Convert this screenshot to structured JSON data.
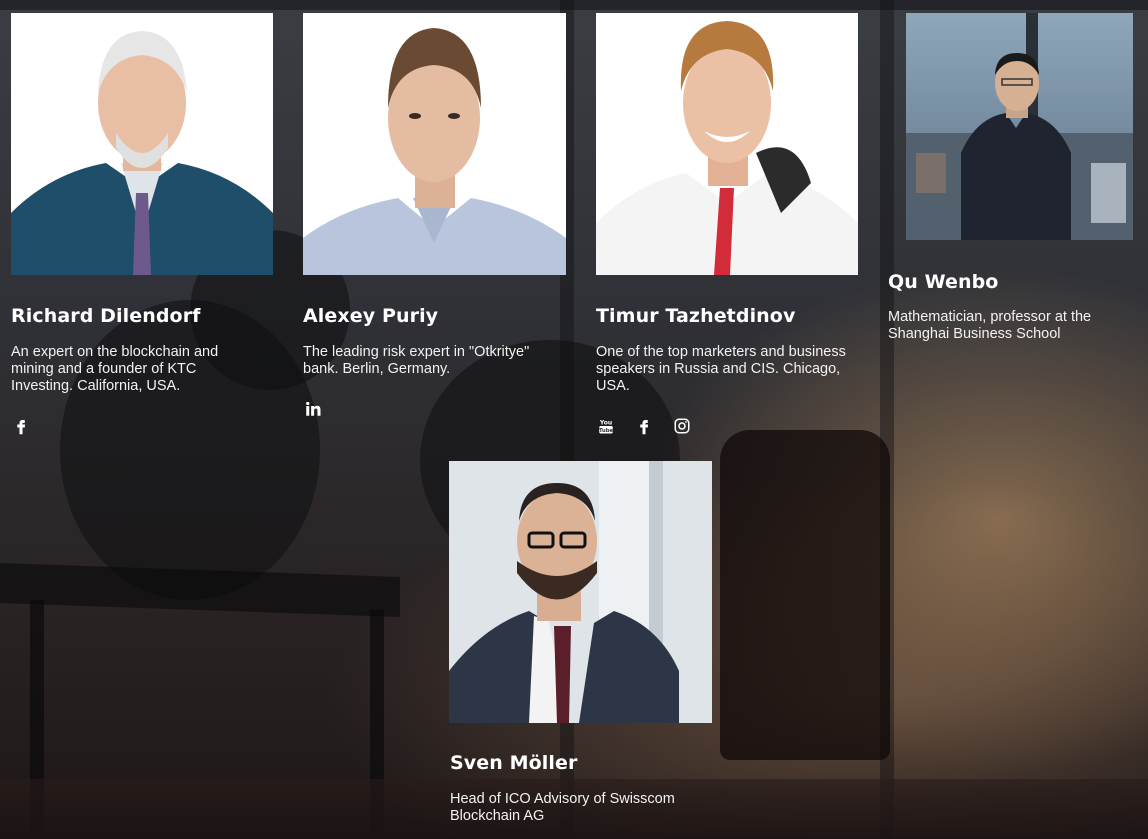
{
  "team": [
    {
      "name": "Richard Dilendorf",
      "description": "An expert on the blockchain and mining and a founder of KTC Investing. California, USA.",
      "socials": [
        "facebook-icon"
      ]
    },
    {
      "name": "Alexey Puriy",
      "description": "The leading risk expert in \"Otkritye\" bank. Berlin, Germany.",
      "socials": [
        "linkedin-icon"
      ]
    },
    {
      "name": "Timur Tazhetdinov",
      "description": "One of the top marketers and business speakers in Russia and CIS. Chicago, USA.",
      "socials": [
        "youtube-icon",
        "facebook-icon",
        "instagram-icon"
      ]
    },
    {
      "name": "Qu Wenbo",
      "description": "Mathematician, professor at the Shanghai Business School",
      "socials": []
    },
    {
      "name": "Sven Möller",
      "description": "Head of ICO Advisory of Swisscom Blockchain AG",
      "socials": []
    }
  ],
  "colors": {
    "text": "#ffffff",
    "background": "#2e3034"
  }
}
